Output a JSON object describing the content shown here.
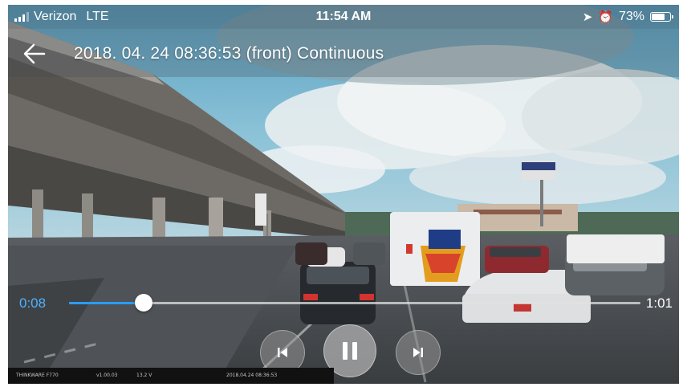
{
  "status_bar": {
    "carrier": "Verizon",
    "network": "LTE",
    "time": "11:54 AM",
    "battery_percent": "73%",
    "battery_level": 0.73,
    "icons": [
      "signal-bars-icon",
      "location-arrow-icon",
      "alarm-clock-icon",
      "battery-icon"
    ]
  },
  "title_bar": {
    "back_icon": "back-arrow-icon",
    "title": "2018. 04. 24 08:36:53 (front) Continuous"
  },
  "player": {
    "current_time": "0:08",
    "total_time": "1:01",
    "progress": 0.13,
    "accent_color": "#2a9cf4",
    "controls": {
      "previous_icon": "skip-previous-icon",
      "pause_icon": "pause-icon",
      "next_icon": "skip-next-icon"
    }
  },
  "video_overlay": {
    "camera_model": "THINKWARE F770",
    "firmware": "v1.00.03",
    "voltage": "13.2 V",
    "timestamp": "2018.04.24 08:36:53"
  }
}
